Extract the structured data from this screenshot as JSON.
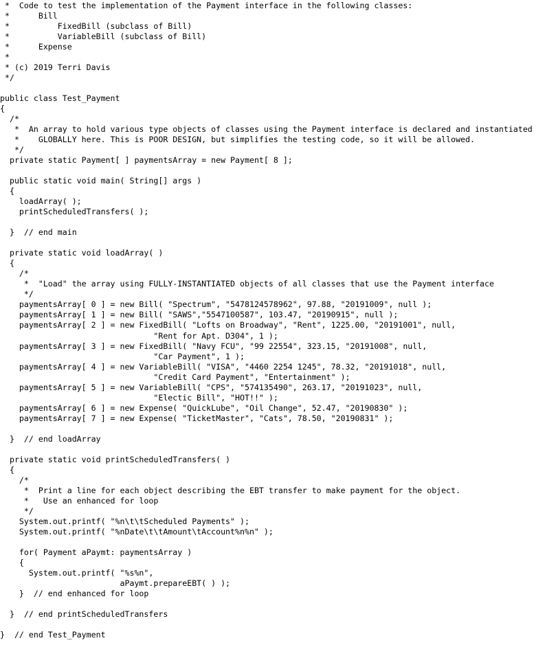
{
  "document": {
    "type": "source-code-listing",
    "language": "Java",
    "class_name": "Test_Payment",
    "background_color": "#ffffff",
    "text_color": "#000000",
    "font_style": "monospace"
  },
  "code": {
    "lines": [
      " *  Code to test the implementation of the Payment interface in the following classes:",
      " *      Bill",
      " *          FixedBill (subclass of Bill)",
      " *          VariableBill (subclass of Bill)",
      " *      Expense",
      " *",
      " * (c) 2019 Terri Davis",
      " */",
      "",
      "public class Test_Payment",
      "{",
      "  /*",
      "   *  An array to hold various type objects of classes using the Payment interface is declared and instantiated",
      "   *    GLOBALLY here. This is POOR DESIGN, but simplifies the testing code, so it will be allowed.",
      "   */",
      "  private static Payment[ ] paymentsArray = new Payment[ 8 ];",
      "",
      "  public static void main( String[] args )",
      "  {",
      "    loadArray( );",
      "    printScheduledTransfers( );",
      "",
      "  }  // end main",
      "",
      "  private static void loadArray( )",
      "  {",
      "    /*",
      "     *  \"Load\" the array using FULLY-INSTANTIATED objects of all classes that use the Payment interface",
      "     */",
      "    paymentsArray[ 0 ] = new Bill( \"Spectrum\", \"5478124578962\", 97.88, \"20191009\", null );",
      "    paymentsArray[ 1 ] = new Bill( \"SAWS\",\"5547100587\", 103.47, \"20190915\", null );",
      "    paymentsArray[ 2 ] = new FixedBill( \"Lofts on Broadway\", \"Rent\", 1225.00, \"20191001\", null,",
      "                                \"Rent for Apt. D304\", 1 );",
      "    paymentsArray[ 3 ] = new FixedBill( \"Navy FCU\", \"99 22554\", 323.15, \"20191008\", null,",
      "                                \"Car Payment\", 1 );",
      "    paymentsArray[ 4 ] = new VariableBill( \"VISA\", \"4460 2254 1245\", 78.32, \"20191018\", null,",
      "                                \"Credit Card Payment\", \"Entertainment\" );",
      "    paymentsArray[ 5 ] = new VariableBill( \"CPS\", \"574135490\", 263.17, \"20191023\", null,",
      "                                \"Electic Bill\", \"HOT!!\" );",
      "    paymentsArray[ 6 ] = new Expense( \"QuickLube\", \"Oil Change\", 52.47, \"20190830\" );",
      "    paymentsArray[ 7 ] = new Expense( \"TicketMaster\", \"Cats\", 78.50, \"20190831\" );",
      "",
      "  }  // end loadArray",
      "",
      "  private static void printScheduledTransfers( )",
      "  {",
      "    /*",
      "     *  Print a line for each object describing the EBT transfer to make payment for the object.",
      "     *   Use an enhanced for loop",
      "     */",
      "    System.out.printf( \"%n\\t\\tScheduled Payments\" );",
      "    System.out.printf( \"%nDate\\t\\tAmount\\tAccount%n%n\" );",
      "",
      "    for( Payment aPaymt: paymentsArray )",
      "    {",
      "      System.out.printf( \"%s%n\",",
      "                         aPaymt.prepareEBT( ) );",
      "    }  // end enhanced for loop",
      "",
      "  }  // end printScheduledTransfers",
      "",
      "}  // end Test_Payment"
    ]
  }
}
